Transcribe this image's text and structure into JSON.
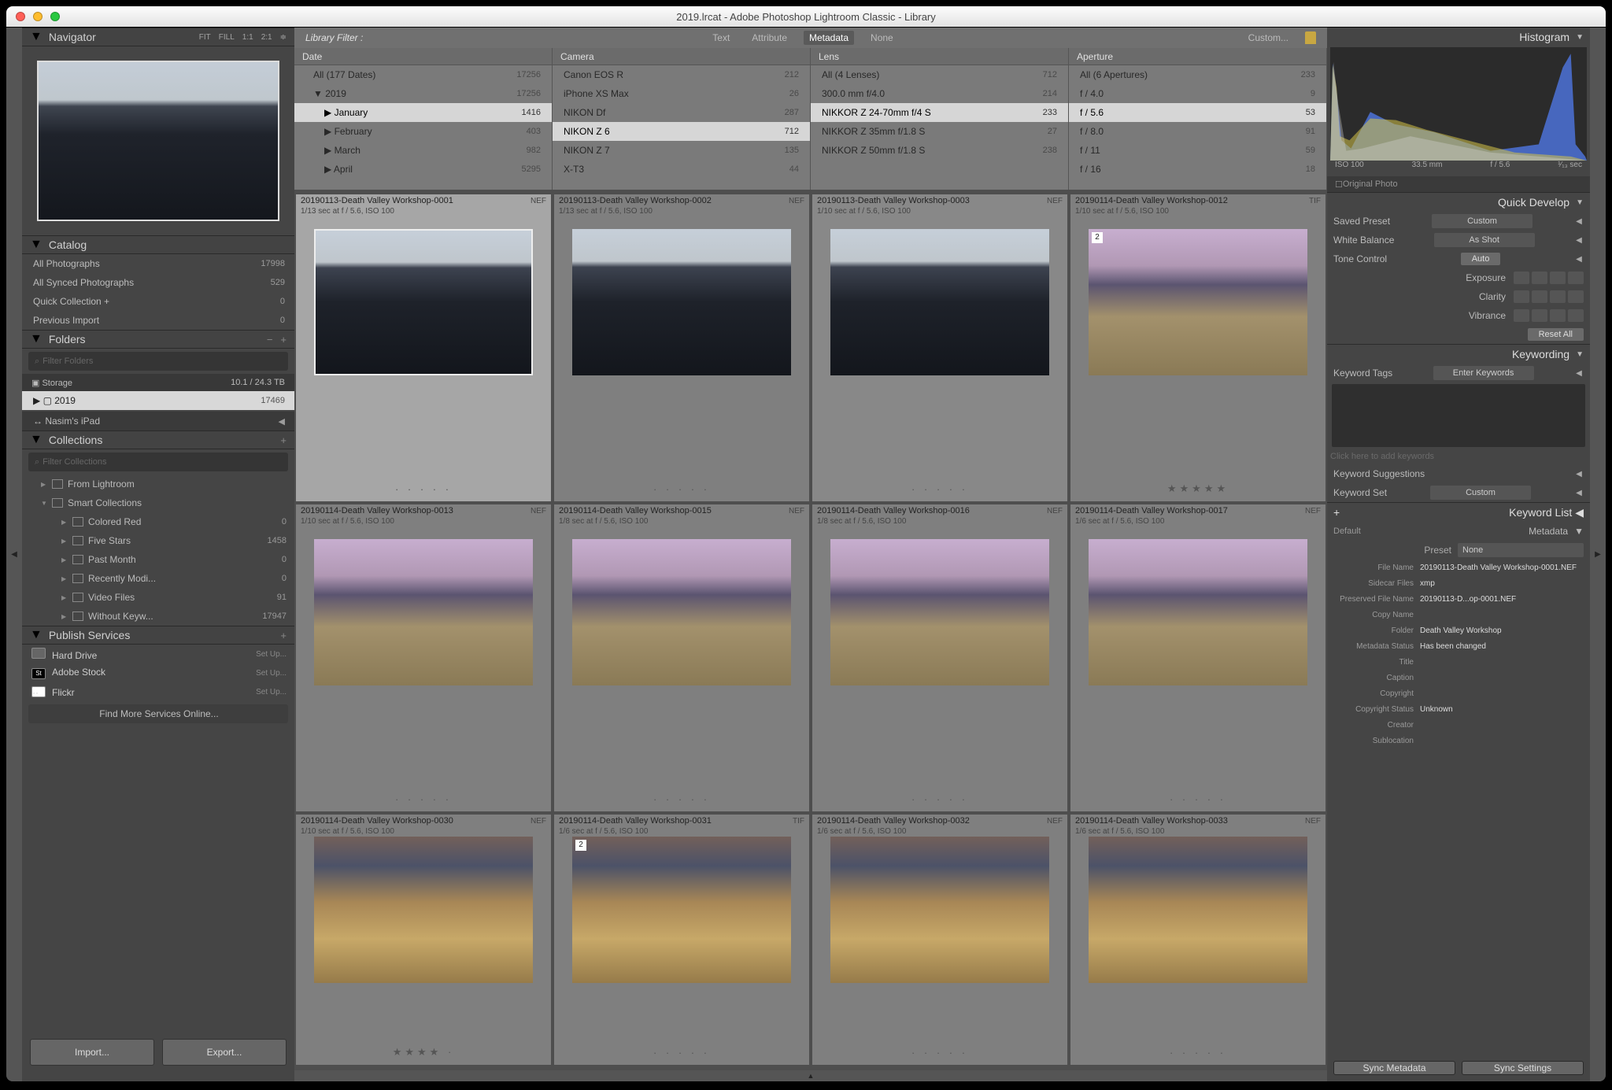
{
  "titlebar": "2019.lrcat - Adobe Photoshop Lightroom Classic - Library",
  "navigator": {
    "title": "Navigator",
    "fit": [
      "FIT",
      "FILL",
      "1:1",
      "2:1"
    ]
  },
  "catalog": {
    "title": "Catalog",
    "rows": [
      {
        "l": "All Photographs",
        "r": "17998"
      },
      {
        "l": "All Synced Photographs",
        "r": "529"
      },
      {
        "l": "Quick Collection  +",
        "r": "0"
      },
      {
        "l": "Previous Import",
        "r": "0"
      }
    ]
  },
  "folders": {
    "title": "Folders",
    "filter": "Filter Folders",
    "storage": {
      "l": "Storage",
      "r": "10.1 / 24.3 TB"
    },
    "year": {
      "l": "2019",
      "r": "17469"
    },
    "ipad": "Nasim's iPad"
  },
  "collections": {
    "title": "Collections",
    "filter": "Filter Collections",
    "rows": [
      {
        "l": "From Lightroom",
        "r": "",
        "ind": 1,
        "tri": "▶"
      },
      {
        "l": "Smart Collections",
        "r": "",
        "ind": 1,
        "tri": "▼"
      },
      {
        "l": "Colored Red",
        "r": "0",
        "ind": 2,
        "tri": "▶"
      },
      {
        "l": "Five Stars",
        "r": "1458",
        "ind": 2,
        "tri": "▶"
      },
      {
        "l": "Past Month",
        "r": "0",
        "ind": 2,
        "tri": "▶"
      },
      {
        "l": "Recently Modi...",
        "r": "0",
        "ind": 2,
        "tri": "▶"
      },
      {
        "l": "Video Files",
        "r": "91",
        "ind": 2,
        "tri": "▶"
      },
      {
        "l": "Without Keyw...",
        "r": "17947",
        "ind": 2,
        "tri": "▶"
      }
    ]
  },
  "publish": {
    "title": "Publish Services",
    "rows": [
      {
        "icon": "hd",
        "l": "Hard Drive",
        "r": "Set Up..."
      },
      {
        "icon": "st",
        "l": "Adobe Stock",
        "r": "Set Up..."
      },
      {
        "icon": "fl",
        "l": "Flickr",
        "r": "Set Up..."
      }
    ],
    "find": "Find More Services Online..."
  },
  "import_btn": "Import...",
  "export_btn": "Export...",
  "libfilter": {
    "label": "Library Filter :",
    "tabs": [
      "Text",
      "Attribute",
      "Metadata",
      "None"
    ],
    "custom": "Custom..."
  },
  "fcols": [
    {
      "h": "Date",
      "rows": [
        {
          "l": "All (177 Dates)",
          "r": "17256",
          "ind": 0
        },
        {
          "l": "2019",
          "r": "17256",
          "ind": 0,
          "tri": "▼",
          "sel": true
        },
        {
          "l": "January",
          "r": "1416",
          "ind": 1,
          "tri": "▶",
          "hl": true
        },
        {
          "l": "February",
          "r": "403",
          "ind": 1,
          "tri": "▶"
        },
        {
          "l": "March",
          "r": "982",
          "ind": 1,
          "tri": "▶"
        },
        {
          "l": "April",
          "r": "5295",
          "ind": 1,
          "tri": "▶"
        }
      ]
    },
    {
      "h": "Camera",
      "rows": [
        {
          "l": "Canon EOS R",
          "r": "212"
        },
        {
          "l": "iPhone XS Max",
          "r": "26"
        },
        {
          "l": "NIKON Df",
          "r": "287"
        },
        {
          "l": "NIKON Z 6",
          "r": "712",
          "hl": true,
          "sel": true
        },
        {
          "l": "NIKON Z 7",
          "r": "135"
        },
        {
          "l": "X-T3",
          "r": "44"
        }
      ]
    },
    {
      "h": "Lens",
      "rows": [
        {
          "l": "All (4 Lenses)",
          "r": "712"
        },
        {
          "l": "300.0 mm f/4.0",
          "r": "214"
        },
        {
          "l": "NIKKOR Z 24-70mm f/4 S",
          "r": "233",
          "hl": true,
          "sel": true
        },
        {
          "l": "NIKKOR Z 35mm f/1.8 S",
          "r": "27"
        },
        {
          "l": "NIKKOR Z 50mm f/1.8 S",
          "r": "238"
        }
      ]
    },
    {
      "h": "Aperture",
      "rows": [
        {
          "l": "All (6 Apertures)",
          "r": "233"
        },
        {
          "l": "f / 4.0",
          "r": "9"
        },
        {
          "l": "f / 5.6",
          "r": "53",
          "hl": true,
          "sel": true
        },
        {
          "l": "f / 8.0",
          "r": "91"
        },
        {
          "l": "f / 11",
          "r": "59"
        },
        {
          "l": "f / 16",
          "r": "18"
        }
      ]
    }
  ],
  "thumbs": {
    "r1": [
      {
        "fn": "20190113-Death Valley Workshop-0001",
        "meta": "1/13 sec at f / 5.6, ISO 100",
        "ft": "NEF",
        "sel": true,
        "th": "dunes"
      },
      {
        "fn": "20190113-Death Valley Workshop-0002",
        "meta": "1/13 sec at f / 5.6, ISO 100",
        "ft": "NEF",
        "th": "dunes"
      },
      {
        "fn": "20190113-Death Valley Workshop-0003",
        "meta": "1/10 sec at f / 5.6, ISO 100",
        "ft": "NEF",
        "sel2": true,
        "th": "dunes"
      },
      {
        "fn": "20190114-Death Valley Workshop-0012",
        "meta": "1/10 sec at f / 5.6, ISO 100",
        "ft": "TIF",
        "th": "bad",
        "badge": "2",
        "stars": "★★★★★"
      }
    ],
    "r2": [
      {
        "fn": "20190114-Death Valley Workshop-0013",
        "meta": "1/10 sec at f / 5.6, ISO 100",
        "ft": "NEF",
        "th": "bad"
      },
      {
        "fn": "20190114-Death Valley Workshop-0015",
        "meta": "1/8 sec at f / 5.6, ISO 100",
        "ft": "NEF",
        "th": "bad"
      },
      {
        "fn": "20190114-Death Valley Workshop-0016",
        "meta": "1/8 sec at f / 5.6, ISO 100",
        "ft": "NEF",
        "th": "bad"
      },
      {
        "fn": "20190114-Death Valley Workshop-0017",
        "meta": "1/6 sec at f / 5.6, ISO 100",
        "ft": "NEF",
        "th": "bad"
      }
    ],
    "r3": [
      {
        "fn": "20190114-Death Valley Workshop-0030",
        "meta": "1/10 sec at f / 5.6, ISO 100",
        "ft": "NEF",
        "th": "bad2",
        "stars": "★★★★ ·"
      },
      {
        "fn": "20190114-Death Valley Workshop-0031",
        "meta": "1/6 sec at f / 5.6, ISO 100",
        "ft": "TIF",
        "th": "bad2",
        "badge": "2"
      },
      {
        "fn": "20190114-Death Valley Workshop-0032",
        "meta": "1/6 sec at f / 5.6, ISO 100",
        "ft": "NEF",
        "th": "bad2"
      },
      {
        "fn": "20190114-Death Valley Workshop-0033",
        "meta": "1/6 sec at f / 5.6, ISO 100",
        "ft": "NEF",
        "th": "bad2"
      }
    ]
  },
  "histogram": {
    "title": "Histogram"
  },
  "exif": [
    "ISO 100",
    "33.5 mm",
    "f / 5.6",
    "¹⁄₁₃ sec"
  ],
  "orig": "Original Photo",
  "quickdev": {
    "title": "Quick Develop",
    "preset_l": "Saved Preset",
    "preset_v": "Custom",
    "wb_l": "White Balance",
    "wb_v": "As Shot",
    "tone_l": "Tone Control",
    "auto": "Auto",
    "exp": "Exposure",
    "clarity": "Clarity",
    "vib": "Vibrance",
    "reset": "Reset All"
  },
  "keywording": {
    "title": "Keywording",
    "tags_l": "Keyword Tags",
    "tags_v": "Enter Keywords",
    "hint": "Click here to add keywords",
    "sug": "Keyword Suggestions",
    "set_l": "Keyword Set",
    "set_v": "Custom"
  },
  "kwlist": {
    "title": "Keyword List",
    "default": "Default"
  },
  "metadata": {
    "title": "Metadata",
    "preset_l": "Preset",
    "preset_v": "None",
    "rows": [
      {
        "l": "File Name",
        "v": "20190113-Death Valley Workshop-0001.NEF"
      },
      {
        "l": "Sidecar Files",
        "v": "xmp"
      },
      {
        "l": "Preserved File Name",
        "v": "20190113-D...op-0001.NEF"
      },
      {
        "l": "Copy Name",
        "v": ""
      },
      {
        "l": "Folder",
        "v": "Death Valley Workshop"
      },
      {
        "l": "Metadata Status",
        "v": "Has been changed"
      },
      {
        "l": "Title",
        "v": ""
      },
      {
        "l": "Caption",
        "v": ""
      },
      {
        "l": "Copyright",
        "v": ""
      },
      {
        "l": "Copyright Status",
        "v": "Unknown"
      },
      {
        "l": "Creator",
        "v": ""
      },
      {
        "l": "Sublocation",
        "v": ""
      }
    ]
  },
  "sync": {
    "meta": "Sync Metadata",
    "set": "Sync Settings"
  },
  "plus": "+"
}
